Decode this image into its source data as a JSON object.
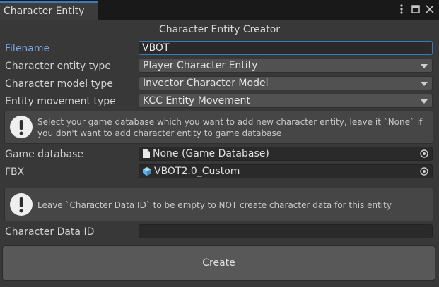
{
  "window": {
    "tab_title": "Character Entity",
    "menu_icon": "kebab-menu-icon",
    "maximize_icon": "maximize-icon",
    "close_icon": "close-icon"
  },
  "header": {
    "title": "Character Entity Creator"
  },
  "form": {
    "filename": {
      "label": "Filename",
      "value": "VBOT"
    },
    "entity_type": {
      "label": "Character entity type",
      "value": "Player Character Entity"
    },
    "model_type": {
      "label": "Character model type",
      "value": "Invector Character Model"
    },
    "movement_type": {
      "label": "Entity movement type",
      "value": "KCC Entity Movement"
    },
    "help_database": "Select your game database which you want to add new character entity, leave it `None` if you don't want to add character entity to game database",
    "game_database": {
      "label": "Game database",
      "value": "None (Game Database)"
    },
    "fbx": {
      "label": "FBX",
      "value": "VBOT2.0_Custom"
    },
    "help_character_data": "Leave `Character Data ID` to be empty to NOT create character data for this entity",
    "character_data_id": {
      "label": "Character Data ID",
      "value": ""
    }
  },
  "actions": {
    "create_label": "Create"
  },
  "colors": {
    "accent": "#3a79bb",
    "background": "#383838",
    "tabbar": "#191919"
  }
}
